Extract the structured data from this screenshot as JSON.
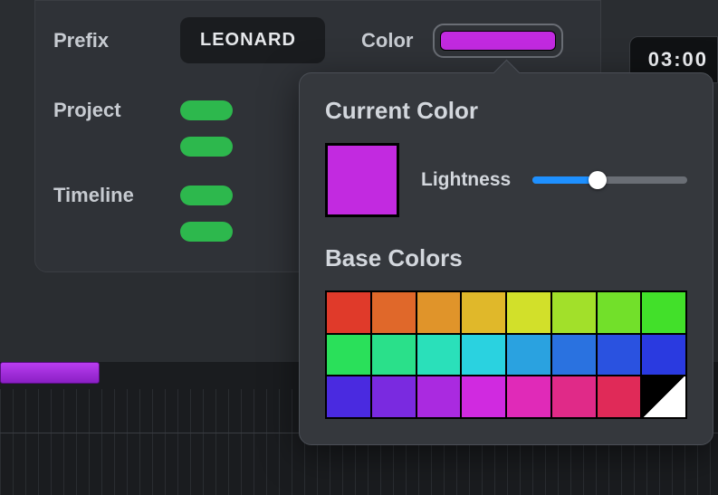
{
  "settings": {
    "prefix_label": "Prefix",
    "prefix_value": "LEONARD",
    "color_label": "Color",
    "current_color": "#c22ae0",
    "project_label": "Project",
    "timeline_label": "Timeline"
  },
  "time_display": "03:00",
  "popover": {
    "current_heading": "Current Color",
    "lightness_label": "Lightness",
    "lightness_value": 42,
    "base_heading": "Base Colors",
    "swatches": [
      "#e03a2a",
      "#e0682a",
      "#e0942a",
      "#e0b82a",
      "#d2e02a",
      "#a2e02a",
      "#72e02a",
      "#42e02a",
      "#2ae05a",
      "#2ae08a",
      "#2ae0ba",
      "#2ad2e0",
      "#2aa2e0",
      "#2a72e0",
      "#2a52e0",
      "#2a3ae0",
      "#4a2ae0",
      "#7a2ae0",
      "#aa2ae0",
      "#d02ae0",
      "#e02ab8",
      "#e02a88",
      "#e02a58",
      "split"
    ]
  }
}
